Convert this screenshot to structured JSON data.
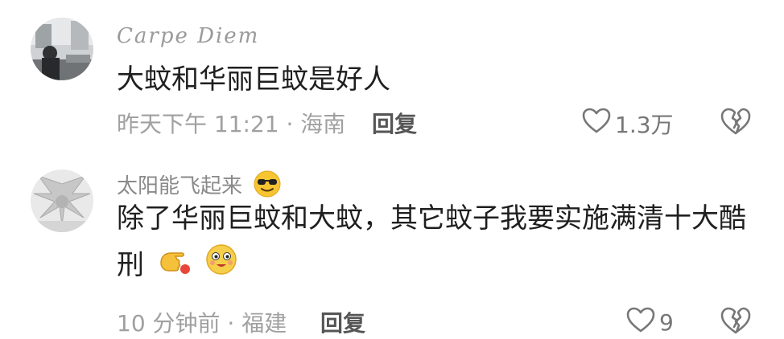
{
  "comments": [
    {
      "username": "Carpe Diem",
      "text": "大蚊和华丽巨蚊是好人",
      "meta": "昨天下午 11:21 · 海南",
      "reply_label": "回复",
      "likes": "1.3万",
      "icons": {
        "like": "heart-outline-icon",
        "dislike": "broken-heart-icon"
      }
    },
    {
      "username": "太阳能飞起来",
      "username_emoji": "sunglasses-face-emoji",
      "text": "除了华丽巨蚊和大蚊，其它蚊子我要实施满清十大酷刑",
      "text_emojis": [
        "pointing-hand-emoji",
        "smiling-face-emoji"
      ],
      "meta": "10 分钟前 · 福建",
      "reply_label": "回复",
      "likes": "9",
      "icons": {
        "like": "heart-outline-icon",
        "dislike": "broken-heart-icon"
      }
    }
  ]
}
